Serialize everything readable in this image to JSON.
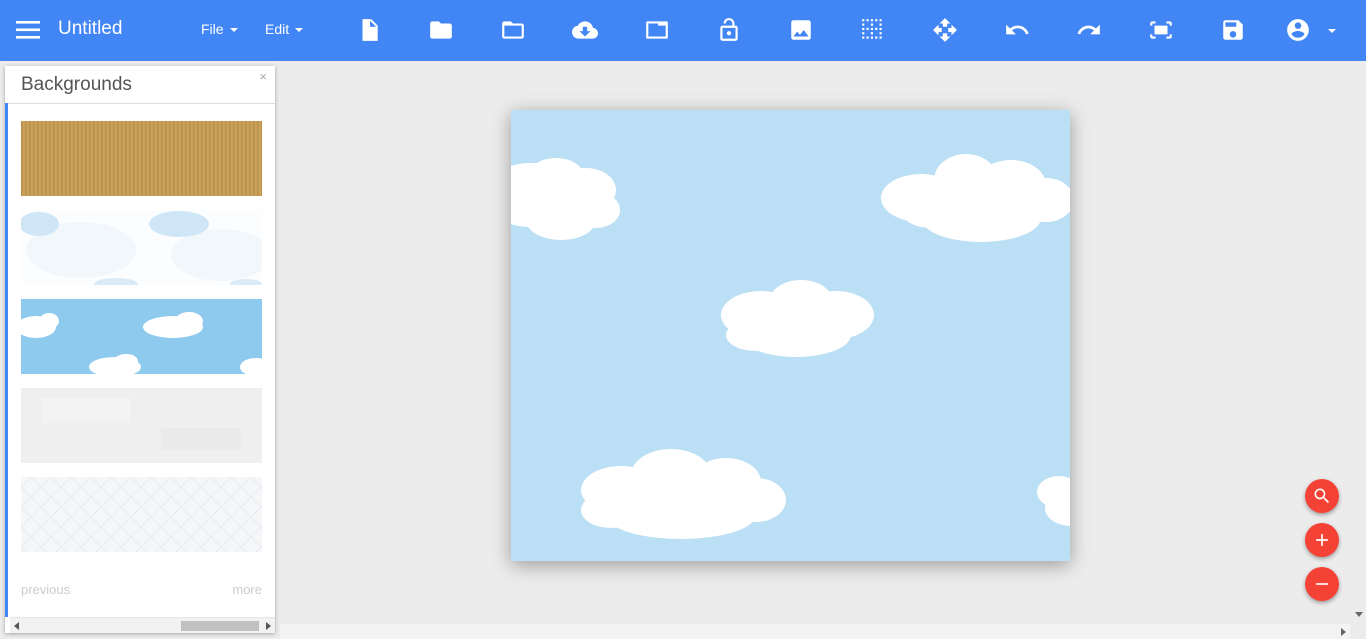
{
  "app": {
    "title": "Untitled",
    "accent_color": "#4285f4",
    "fab_color": "#f44336"
  },
  "menus": {
    "file_label": "File",
    "edit_label": "Edit"
  },
  "toolbar": {
    "icons": [
      "new-file-icon",
      "folder-icon",
      "open-folder-icon",
      "cloud-download-icon",
      "window-icon",
      "unlock-icon",
      "image-icon",
      "grid-icon",
      "move-icon",
      "undo-icon",
      "redo-icon",
      "fit-screen-icon",
      "save-icon",
      "account-icon"
    ]
  },
  "panel": {
    "title": "Backgrounds",
    "close_label": "×",
    "thumbnails": [
      "cardboard-texture",
      "light-clouds-pattern",
      "blue-sky-clouds-pattern",
      "light-gray-paper-texture",
      "subtle-pattern-texture"
    ],
    "previous_label": "previous",
    "more_label": "more"
  },
  "canvas": {
    "background": "blue-sky-clouds",
    "sky_color": "#bbdff4"
  },
  "fabs": [
    "zoom-icon",
    "zoom-in-icon",
    "zoom-out-icon"
  ]
}
